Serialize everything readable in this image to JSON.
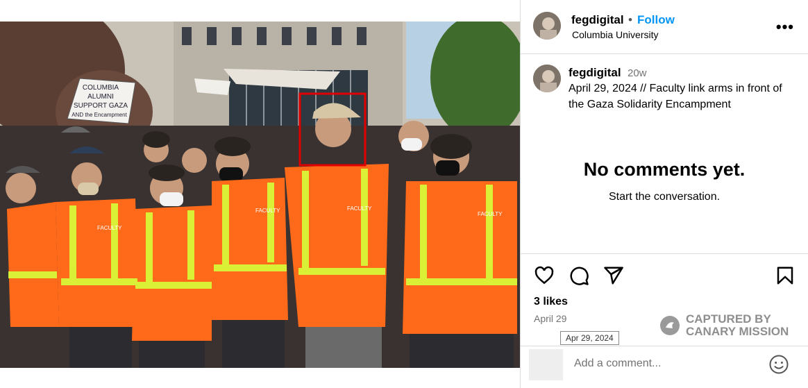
{
  "post": {
    "username": "fegdigital",
    "follow_label": "Follow",
    "separator": "•",
    "location": "Columbia University",
    "more_label": "•••"
  },
  "caption": {
    "username": "fegdigital",
    "age": "20w",
    "text": "April 29, 2024 // Faculty link arms in front of the Gaza Solidarity Encampment"
  },
  "comments": {
    "empty_title": "No comments yet.",
    "empty_subtitle": "Start the conversation."
  },
  "actions": {
    "icons": [
      "heart-icon",
      "comment-icon",
      "share-icon",
      "bookmark-icon"
    ]
  },
  "likes": "3 likes",
  "date": "April 29",
  "date_tooltip": "Apr 29, 2024",
  "watermark": {
    "line1": "CAPTURED BY",
    "line2": "CANARY MISSION"
  },
  "comment_input": {
    "placeholder": "Add a comment..."
  },
  "photo": {
    "signs": [
      "COLUMBIA",
      "ALUMNI",
      "SUPPORT GAZA",
      "AND the Encampment"
    ],
    "vest_label": "FACULTY"
  },
  "colors": {
    "accent": "#0095f6",
    "highlight_box": "#e00000",
    "vest": "#ff6a1a"
  }
}
